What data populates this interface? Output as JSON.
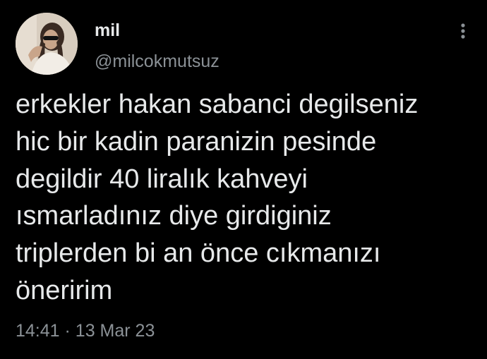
{
  "tweet": {
    "display_name": "mil",
    "handle": "@milcokmutsuz",
    "text": "erkekler hakan sabanci degilseniz\nhic bir kadin paranizin pesinde\ndegildir 40 liralık kahveyi\nısmarladınız diye girdiginiz\ntriplerden bi an önce cıkmanızı\nöneririm",
    "time": "14:41",
    "separator": "·",
    "date": "13 Mar 23"
  },
  "icons": {
    "more": "more-vertical-icon"
  },
  "colors": {
    "background": "#000000",
    "primary_text": "#e7e9ea",
    "secondary_text": "#8b9196"
  }
}
